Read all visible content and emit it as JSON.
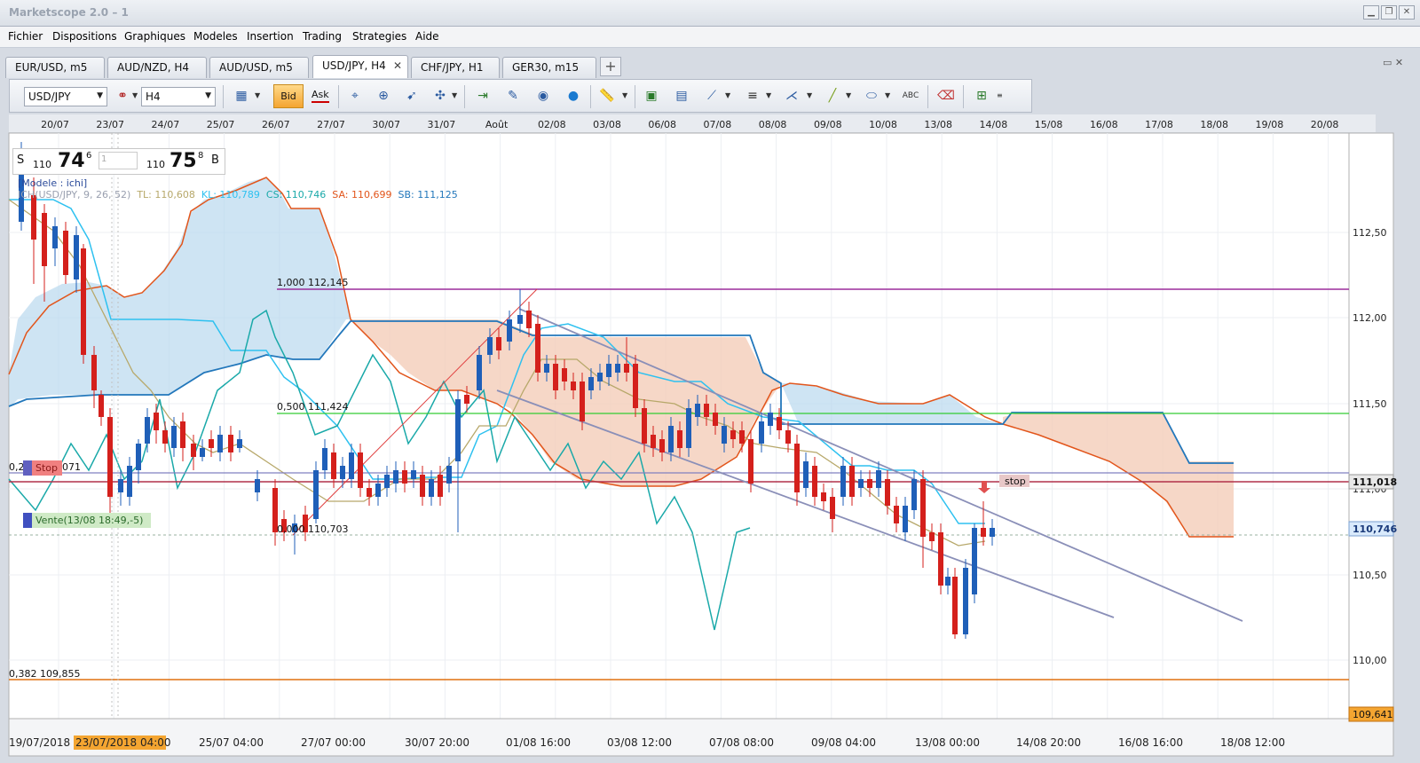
{
  "app": {
    "title": "Marketscope 2.0 – 1"
  },
  "window_controls": {
    "minimize": "▁",
    "restore": "❐",
    "close": "✕"
  },
  "menu": [
    "Fichier",
    "Dispositions",
    "Graphiques",
    "Modeles",
    "Insertion",
    "Trading",
    "Strategies",
    "Aide"
  ],
  "tabs": [
    {
      "label": "EUR/USD, m5"
    },
    {
      "label": "AUD/NZD, H4"
    },
    {
      "label": "AUD/USD, m5"
    },
    {
      "label": "USD/JPY, H4",
      "active": true
    },
    {
      "label": "CHF/JPY, H1"
    },
    {
      "label": "GER30, m15"
    }
  ],
  "toolbar": {
    "instrument": "USD/JPY",
    "timeframe": "H4",
    "bid_label": "Bid",
    "ask_label": "Ask"
  },
  "quote": {
    "sell_label": "S",
    "sell_big": "110",
    "sell_main": "74",
    "sell_sup": "6",
    "lot": "1",
    "buy_big": "110",
    "buy_main": "75",
    "buy_sup": "8",
    "buy_label": "B"
  },
  "indicator": {
    "modele": "[Modele : ichi]",
    "name": "ICH(USD/JPY, 9, 26, 52)",
    "tl": "TL: 110,608",
    "kl": "KL: 110,789",
    "cs": "CS: 110,746",
    "sa": "SA: 110,699",
    "sb": "SB: 111,125",
    "colors": {
      "name": "#9aa0b0",
      "tl": "#b7a86a",
      "kl": "#2ec1f0",
      "cs": "#1aa9a9",
      "sa": "#e2551b",
      "sb": "#2277bb"
    }
  },
  "top_dates": [
    "20/07",
    "23/07",
    "24/07",
    "25/07",
    "26/07",
    "27/07",
    "30/07",
    "31/07",
    "Août",
    "02/08",
    "03/08",
    "06/08",
    "07/08",
    "08/08",
    "09/08",
    "10/08",
    "13/08",
    "14/08",
    "15/08",
    "16/08",
    "17/08",
    "18/08",
    "19/08",
    "20/08"
  ],
  "bottom_dates": [
    "19/07/2018 0",
    "23/07/2018 04:00",
    "25/07 04:00",
    "27/07 00:00",
    "30/07 20:00",
    "01/08 16:00",
    "03/08 12:00",
    "07/08 08:00",
    "09/08 04:00",
    "13/08 00:00",
    "14/08 20:00",
    "16/08 16:00",
    "18/08 12:00"
  ],
  "price_labels": [
    "112,50",
    "112,00",
    "111,50",
    "111,00",
    "110,50",
    "110,00"
  ],
  "price_tags": {
    "stop": "111,018",
    "current": "110,746",
    "fib382": "109,641"
  },
  "fib": {
    "f1000": "1,000 112,145",
    "f500": "0,500 111,424",
    "f0": "0,000 110,703",
    "f382": "0,382 109,855",
    "left_2": "0,2",
    "left_071": "071"
  },
  "orders": {
    "stop_left": "Stop",
    "stop_right": "stop",
    "vente": "Vente(13/08 18:49,-5)"
  },
  "chart_data": {
    "type": "candlestick",
    "instrument": "USD/JPY",
    "timeframe": "H4",
    "ylim": [
      109.64,
      112.95
    ],
    "horizontal_levels": [
      {
        "label": "1,000 112,145",
        "value": 112.145,
        "color": "#9b2d9b"
      },
      {
        "label": "0,500 111,424",
        "value": 111.424,
        "color": "#33cc33"
      },
      {
        "label": "0,000 110,703",
        "value": 110.703
      },
      {
        "label": "0,382 109,855",
        "value": 109.855,
        "color": "#e07010"
      },
      {
        "label": "stop",
        "value": 111.018,
        "color": "#b0304a"
      }
    ],
    "current_price": 110.746,
    "series": [
      {
        "name": "TL",
        "color": "#b7a86a"
      },
      {
        "name": "KL",
        "color": "#2ec1f0"
      },
      {
        "name": "CS",
        "color": "#1aa9a9"
      },
      {
        "name": "SA",
        "color": "#e2551b"
      },
      {
        "name": "SB",
        "color": "#2277bb"
      }
    ]
  }
}
